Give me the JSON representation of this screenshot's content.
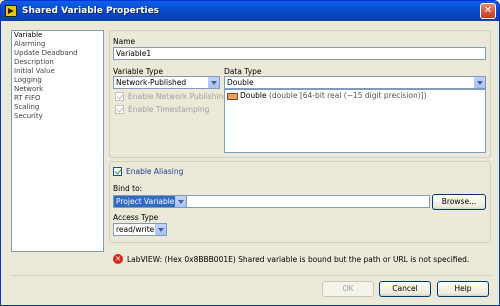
{
  "window": {
    "title": "Shared Variable Properties",
    "close_glyph": "✕"
  },
  "sidebar": {
    "items": [
      {
        "label": "Variable"
      },
      {
        "label": "Alarming"
      },
      {
        "label": "Update Deadband"
      },
      {
        "label": "Description"
      },
      {
        "label": "Initial Value"
      },
      {
        "label": "Logging"
      },
      {
        "label": "Network"
      },
      {
        "label": "RT FIFO"
      },
      {
        "label": "Scaling"
      },
      {
        "label": "Security"
      }
    ]
  },
  "variable": {
    "name_label": "Name",
    "name_value": "Variable1",
    "type_label": "Variable Type",
    "type_value": "Network-Published",
    "enable_network_publishing": "Enable Network Publishing",
    "enable_timestamping": "Enable Timestamping",
    "data_type_label": "Data Type",
    "data_type_value": "Double",
    "data_type_list_item": "Double",
    "data_type_list_detail": "(double [64-bit real (~15 digit precision)])"
  },
  "aliasing": {
    "enable_label": "Enable Aliasing",
    "bind_label": "Bind to:",
    "bind_value": "Project Variable",
    "path_value": "",
    "browse_label": "Browse...",
    "access_label": "Access Type",
    "access_value": "read/write"
  },
  "error": {
    "message": "LabVIEW:  (Hex 0x8BBB001E) Shared variable is bound but the path or URL is not specified."
  },
  "buttons": {
    "ok": "OK",
    "cancel": "Cancel",
    "help": "Help"
  },
  "colors": {
    "titlebar": "#0747c8",
    "selection": "#316ac5",
    "error": "#d52b1e"
  },
  "icons": {
    "app": "labview-icon",
    "error": "error-icon",
    "close": "close-icon"
  }
}
